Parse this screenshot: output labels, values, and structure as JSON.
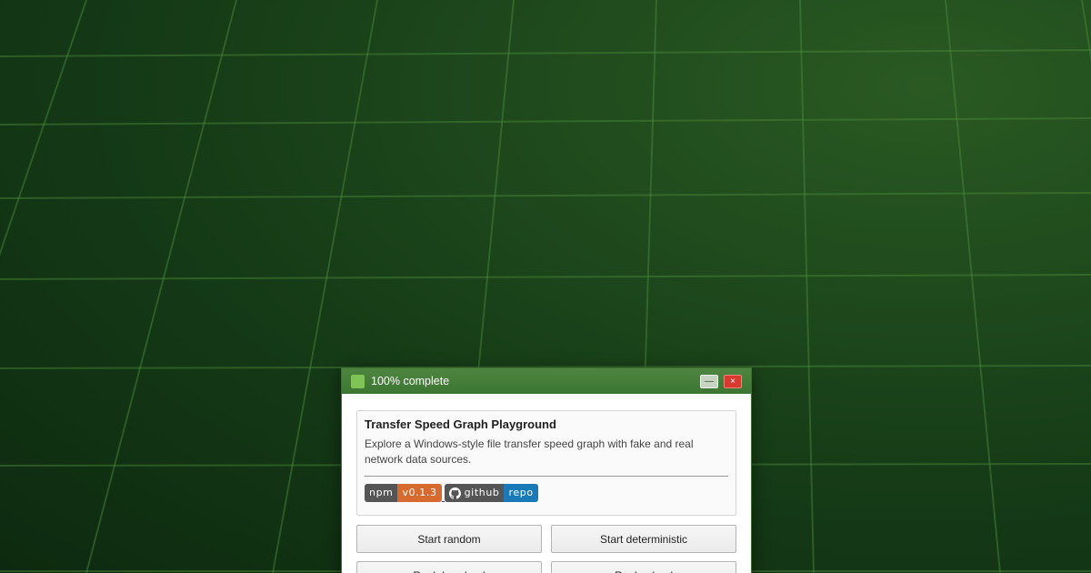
{
  "window": {
    "title": "100% complete",
    "minimize_label": "—",
    "close_label": "×"
  },
  "card": {
    "title": "Transfer Speed Graph Playground",
    "description": "Explore a Windows-style file transfer speed graph with fake and real network data sources."
  },
  "badges": {
    "npm": {
      "label": "npm",
      "value": "v0.1.3"
    },
    "github": {
      "label": "github",
      "value": "repo",
      "icon": "github-icon"
    }
  },
  "buttons": {
    "start_random": "Start random",
    "start_deterministic": "Start deterministic",
    "real_download": "Real download",
    "real_upload": "Real upload"
  },
  "colors": {
    "titlebar": "#4d8540",
    "npm_badge": "#d66a2f",
    "github_badge": "#1a7ab7",
    "close_button": "#d83a2e"
  }
}
